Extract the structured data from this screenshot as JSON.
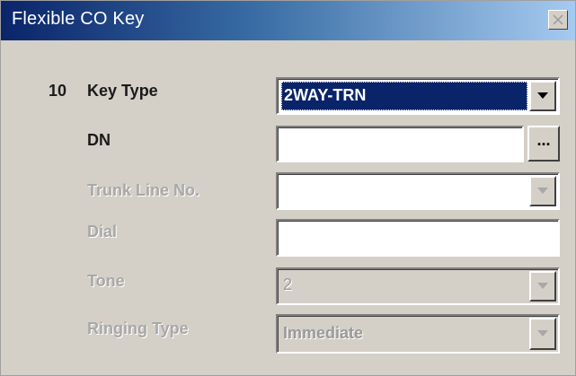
{
  "window": {
    "title": "Flexible CO Key",
    "close_icon": "close-icon"
  },
  "form": {
    "key_number": "10",
    "key_type": {
      "label": "Key Type",
      "value": "2WAY-TRN",
      "enabled": true
    },
    "dn": {
      "label": "DN",
      "value": "",
      "browse_label": "...",
      "enabled": true
    },
    "trunk_line_no": {
      "label": "Trunk Line No.",
      "value": "",
      "enabled": false
    },
    "dial": {
      "label": "Dial",
      "value": "",
      "enabled": false
    },
    "tone": {
      "label": "Tone",
      "value": "2",
      "enabled": false
    },
    "ringing_type": {
      "label": "Ringing Type",
      "value": "Immediate",
      "enabled": false
    }
  },
  "colors": {
    "titlebar_start": "#0a246a",
    "titlebar_end": "#a6caf0",
    "window_bg": "#d4d0c8",
    "selection": "#0a246a",
    "disabled_text": "#a8a8a8"
  }
}
